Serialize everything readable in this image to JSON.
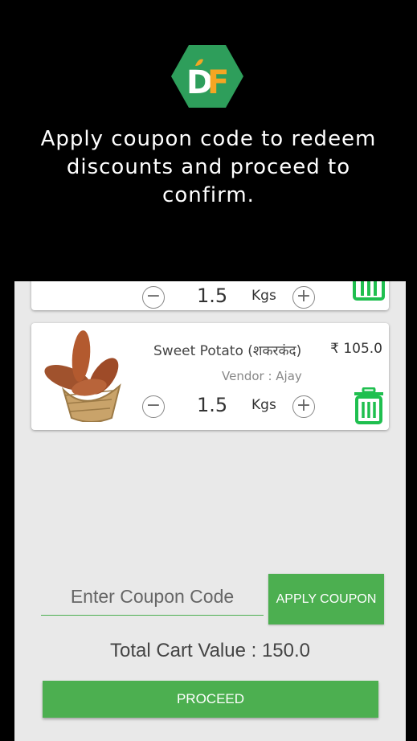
{
  "coach": {
    "logo_text": "DF",
    "message": "Apply coupon code to redeem discounts and proceed to confirm."
  },
  "cart": {
    "items": [
      {
        "name": "",
        "price": "",
        "vendor": "",
        "quantity": "1.5",
        "unit": "Kgs"
      },
      {
        "name": "Sweet Potato (शकरकंद)",
        "price": "₹ 105.0",
        "vendor": "Vendor : Ajay",
        "quantity": "1.5",
        "unit": "Kgs"
      }
    ]
  },
  "coupon": {
    "placeholder": "Enter Coupon Code",
    "value": "",
    "apply_label": "APPLY COUPON"
  },
  "total": {
    "text": "Total Cart Value : 150.0"
  },
  "proceed_label": "PROCEED",
  "colors": {
    "accent": "#4caf50",
    "logo_bg": "#2e9e5b",
    "logo_orange": "#f5a623",
    "overlay": "#000000",
    "app_bg": "#e9e9e9"
  }
}
